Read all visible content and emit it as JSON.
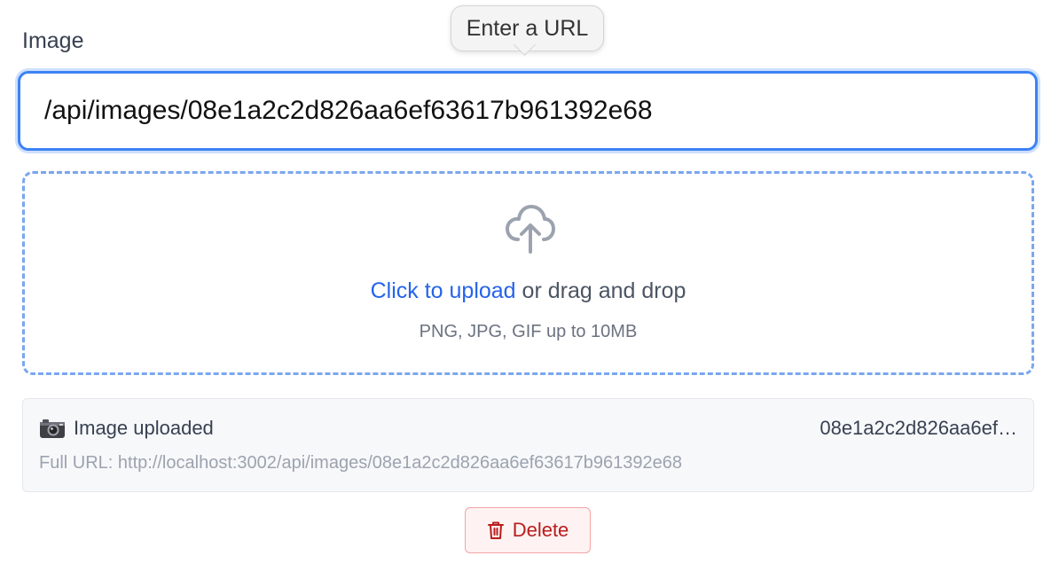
{
  "field": {
    "label": "Image"
  },
  "tooltip": {
    "text": "Enter a URL"
  },
  "url_input": {
    "value": "/api/images/08e1a2c2d826aa6ef63617b961392e68"
  },
  "dropzone": {
    "icon": "cloud-upload-icon",
    "link_text": "Click to upload",
    "rest_text": " or drag and drop",
    "hint": "PNG, JPG, GIF up to 10MB"
  },
  "status": {
    "icon": "camera-icon",
    "label": "Image uploaded",
    "short_id": "08e1a2c2d826aa6ef…",
    "full_url": "Full URL: http://localhost:3002/api/images/08e1a2c2d826aa6ef63617b961392e68"
  },
  "delete_button": {
    "icon": "trash-icon",
    "label": "Delete"
  },
  "colors": {
    "accent": "#3b82f6",
    "link": "#2563eb",
    "danger": "#b91c1c",
    "danger_bg": "#fef2f2"
  }
}
